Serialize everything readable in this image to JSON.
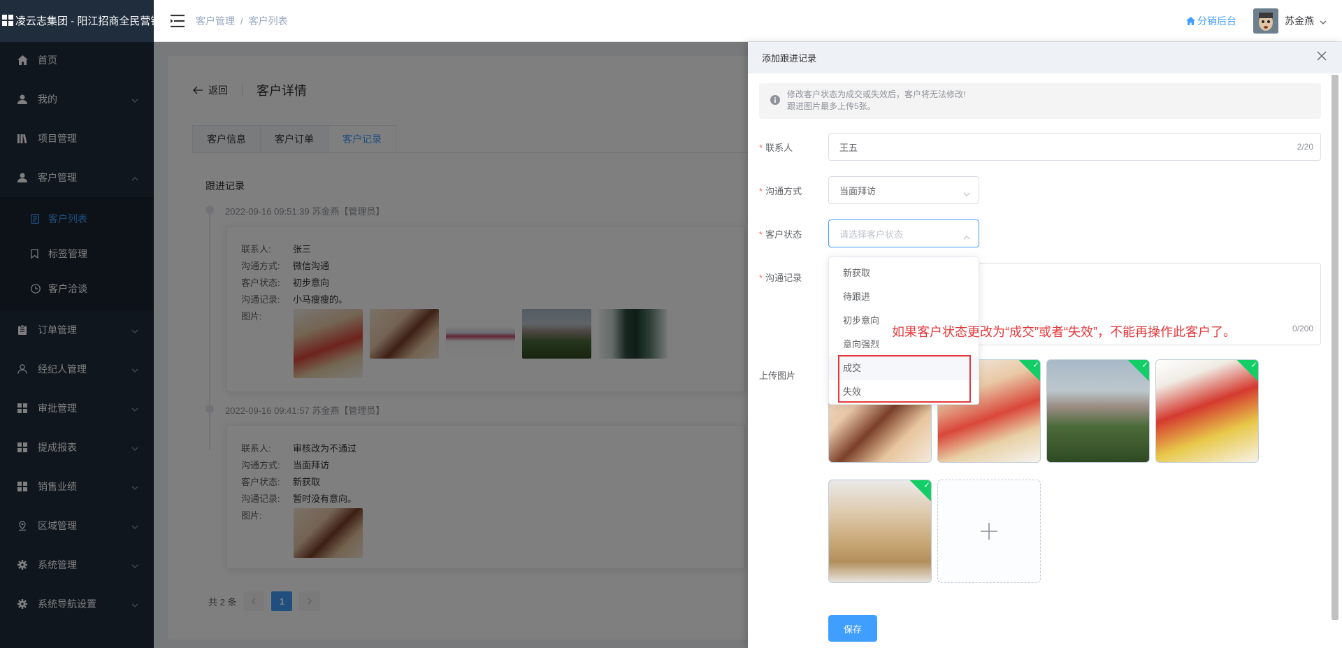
{
  "brand": {
    "title": "凌云志集团 - 阳江招商全民营销"
  },
  "sidebar": {
    "items": [
      {
        "label": "首页",
        "icon": "home-icon"
      },
      {
        "label": "我的",
        "icon": "user-icon"
      },
      {
        "label": "项目管理",
        "icon": "library-icon"
      },
      {
        "label": "客户管理",
        "icon": "user-icon"
      },
      {
        "label": "订单管理",
        "icon": "clipboard-icon"
      },
      {
        "label": "经纪人管理",
        "icon": "user-outline-icon"
      },
      {
        "label": "审批管理",
        "icon": "grid-icon"
      },
      {
        "label": "提成报表",
        "icon": "grid-icon"
      },
      {
        "label": "销售业绩",
        "icon": "grid-icon"
      },
      {
        "label": "区域管理",
        "icon": "location-icon"
      },
      {
        "label": "系统管理",
        "icon": "gear-icon"
      },
      {
        "label": "系统导航设置",
        "icon": "gear-icon"
      }
    ],
    "sub_items": [
      {
        "label": "客户列表",
        "icon": "document-icon"
      },
      {
        "label": "标签管理",
        "icon": "bookmark-icon"
      },
      {
        "label": "客户洽谈",
        "icon": "clock-icon"
      }
    ]
  },
  "header": {
    "breadcrumb_1": "客户管理",
    "breadcrumb_sep": "/",
    "breadcrumb_2": "客户列表",
    "admin_link": "分销后台",
    "username": "苏金燕"
  },
  "page": {
    "back_label": "返回",
    "title": "客户详情",
    "tabs": [
      "客户信息",
      "客户订单",
      "客户记录"
    ],
    "section_title": "跟进记录",
    "records": [
      {
        "meta": "2022-09-16 09:51:39 苏金燕【管理员】",
        "fields": [
          {
            "k": "联系人:",
            "v": "张三"
          },
          {
            "k": "沟通方式:",
            "v": "微信沟通"
          },
          {
            "k": "客户状态:",
            "v": "初步意向"
          },
          {
            "k": "沟通记录:",
            "v": "小马瘦瘦的。"
          },
          {
            "k": "图片:",
            "v": ""
          }
        ]
      },
      {
        "meta": "2022-09-16 09:41:57 苏金燕【管理员】",
        "fields": [
          {
            "k": "联系人:",
            "v": "审核改为不通过"
          },
          {
            "k": "沟通方式:",
            "v": "当面拜访"
          },
          {
            "k": "客户状态:",
            "v": "新获取"
          },
          {
            "k": "沟通记录:",
            "v": "暂时没有意向。"
          },
          {
            "k": "图片:",
            "v": ""
          }
        ]
      }
    ],
    "pager": {
      "total": "共 2 条",
      "current": "1"
    }
  },
  "drawer": {
    "title": "添加跟进记录",
    "alert_line1": "修改客户状态为成交或失效后，客户将无法修改!",
    "alert_line2": "跟进图片最多上传5张。",
    "req_mark": "*",
    "contact_label": "联系人",
    "contact_value": "王五",
    "contact_count": "2/20",
    "method_label": "沟通方式",
    "method_value": "当面拜访",
    "status_label": "客户状态",
    "status_placeholder": "请选择客户状态",
    "record_label": "沟通记录",
    "record_count": "0/200",
    "upload_label": "上传图片",
    "status_options": [
      "新获取",
      "待跟进",
      "初步意向",
      "意向强烈",
      "成交",
      "失效"
    ],
    "save_label": "保存"
  },
  "annotation": "如果客户状态更改为“成交”或者“失效”，不能再操作此客户了。",
  "colors": {
    "primary": "#409eff",
    "sidebar": "#1f2d3d",
    "annotation": "#e4393c",
    "success": "#13ce66"
  }
}
